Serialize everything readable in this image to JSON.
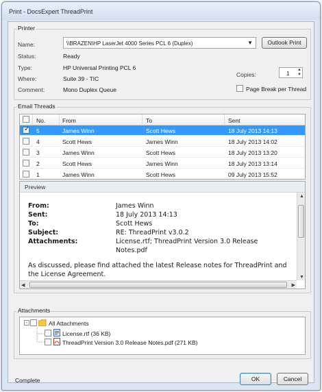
{
  "window": {
    "title": "Print - DocsExpert ThreadPrint"
  },
  "printer": {
    "group_label": "Printer",
    "name_label": "Name:",
    "name_value": "\\\\BRAZEN\\HP LaserJet 4000 Series PCL 6 (Duplex)",
    "outlook_button": "Outlook Print",
    "status_label": "Status:",
    "status_value": "Ready",
    "type_label": "Type:",
    "type_value": "HP Universal Printing PCL 6",
    "where_label": "Where:",
    "where_value": "Suite 39 - TIC",
    "comment_label": "Comment:",
    "comment_value": "Mono Duplex Queue",
    "copies_label": "Copies:",
    "copies_value": "1",
    "page_break_label": "Page Break per Thread",
    "page_break_checked": false
  },
  "threads": {
    "group_label": "Email Threads",
    "columns": [
      "No.",
      "From",
      "To",
      "Sent"
    ],
    "rows": [
      {
        "no": "5",
        "from": "James Winn",
        "to": "Scott Hews",
        "sent": "18 July 2013 14:13",
        "checked": true,
        "selected": true
      },
      {
        "no": "4",
        "from": "Scott Hews",
        "to": "James Winn",
        "sent": "18 July 2013 14:02",
        "checked": false,
        "selected": false
      },
      {
        "no": "3",
        "from": "James Winn",
        "to": "Scott Hews",
        "sent": "18 July 2013 13:20",
        "checked": false,
        "selected": false
      },
      {
        "no": "2",
        "from": "Scott Hews",
        "to": "James Winn",
        "sent": "18 July 2013 13:14",
        "checked": false,
        "selected": false
      },
      {
        "no": "1",
        "from": "James Winn",
        "to": "Scott Hews",
        "sent": "09 July 2013 15:52",
        "checked": false,
        "selected": false
      }
    ]
  },
  "preview": {
    "label": "Preview",
    "from_label": "From:",
    "from_value": "James Winn",
    "sent_label": "Sent:",
    "sent_value": "18 July 2013 14:13",
    "to_label": "To:",
    "to_value": "Scott Hews",
    "subject_label": "Subject:",
    "subject_value": "RE: ThreadPrint v3.0.2",
    "attachments_label": "Attachments:",
    "attachments_line1": "License.rtf; ThreadPrint Version 3.0 Release",
    "attachments_line2": "Notes.pdf",
    "body_line1": "As discussed, please find attached the latest Release notes for ThreadPrint and",
    "body_line2": "the License Agreement."
  },
  "attachments": {
    "group_label": "Attachments",
    "root": "All Attachments",
    "items": [
      {
        "name": "License.rtf (36 KB)",
        "icon": "rtf-file-icon"
      },
      {
        "name": "ThreadPrint Version 3.0 Release Notes.pdf (271 KB)",
        "icon": "pdf-file-icon"
      }
    ]
  },
  "footer": {
    "status": "Complete",
    "ok": "OK",
    "cancel": "Cancel"
  },
  "colors": {
    "selection": "#3399ff",
    "window_frame": "#dce6f2"
  }
}
